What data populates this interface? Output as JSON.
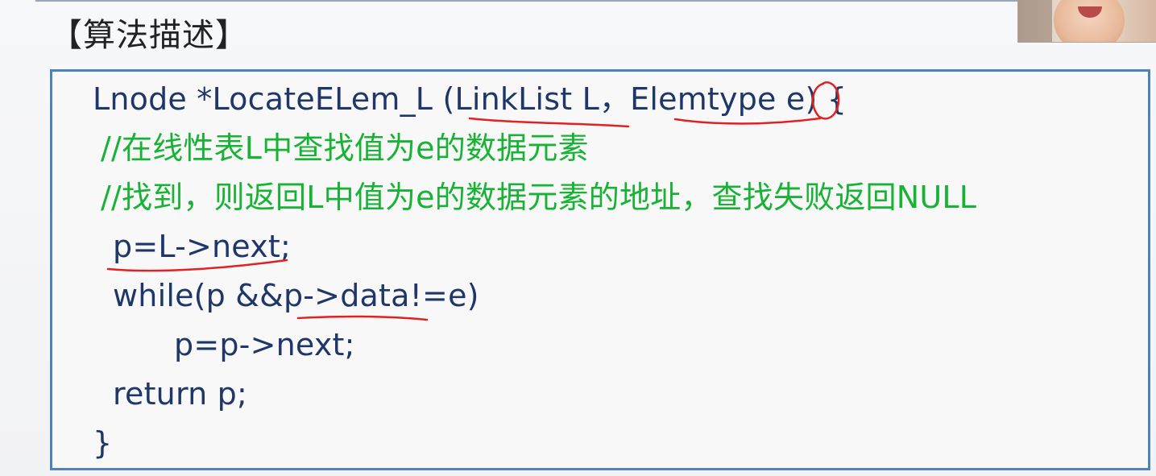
{
  "slide": {
    "title": "【算法描述】",
    "code": {
      "lines": [
        "Lnode *LocateELem_L (LinkList L，Elemtype e) {",
        "//在线性表L中查找值为e的数据元素",
        "//找到，则返回L中值为e的数据元素的地址，查找失败返回NULL",
        "p=L->next;",
        "while(p &&p->data!=e)",
        "p=p->next;",
        "return p;",
        "}"
      ]
    }
  },
  "colors": {
    "code_text": "#1f3768",
    "comment_text": "#18b235",
    "box_border": "#4f81bd",
    "ink": "#e02222"
  }
}
